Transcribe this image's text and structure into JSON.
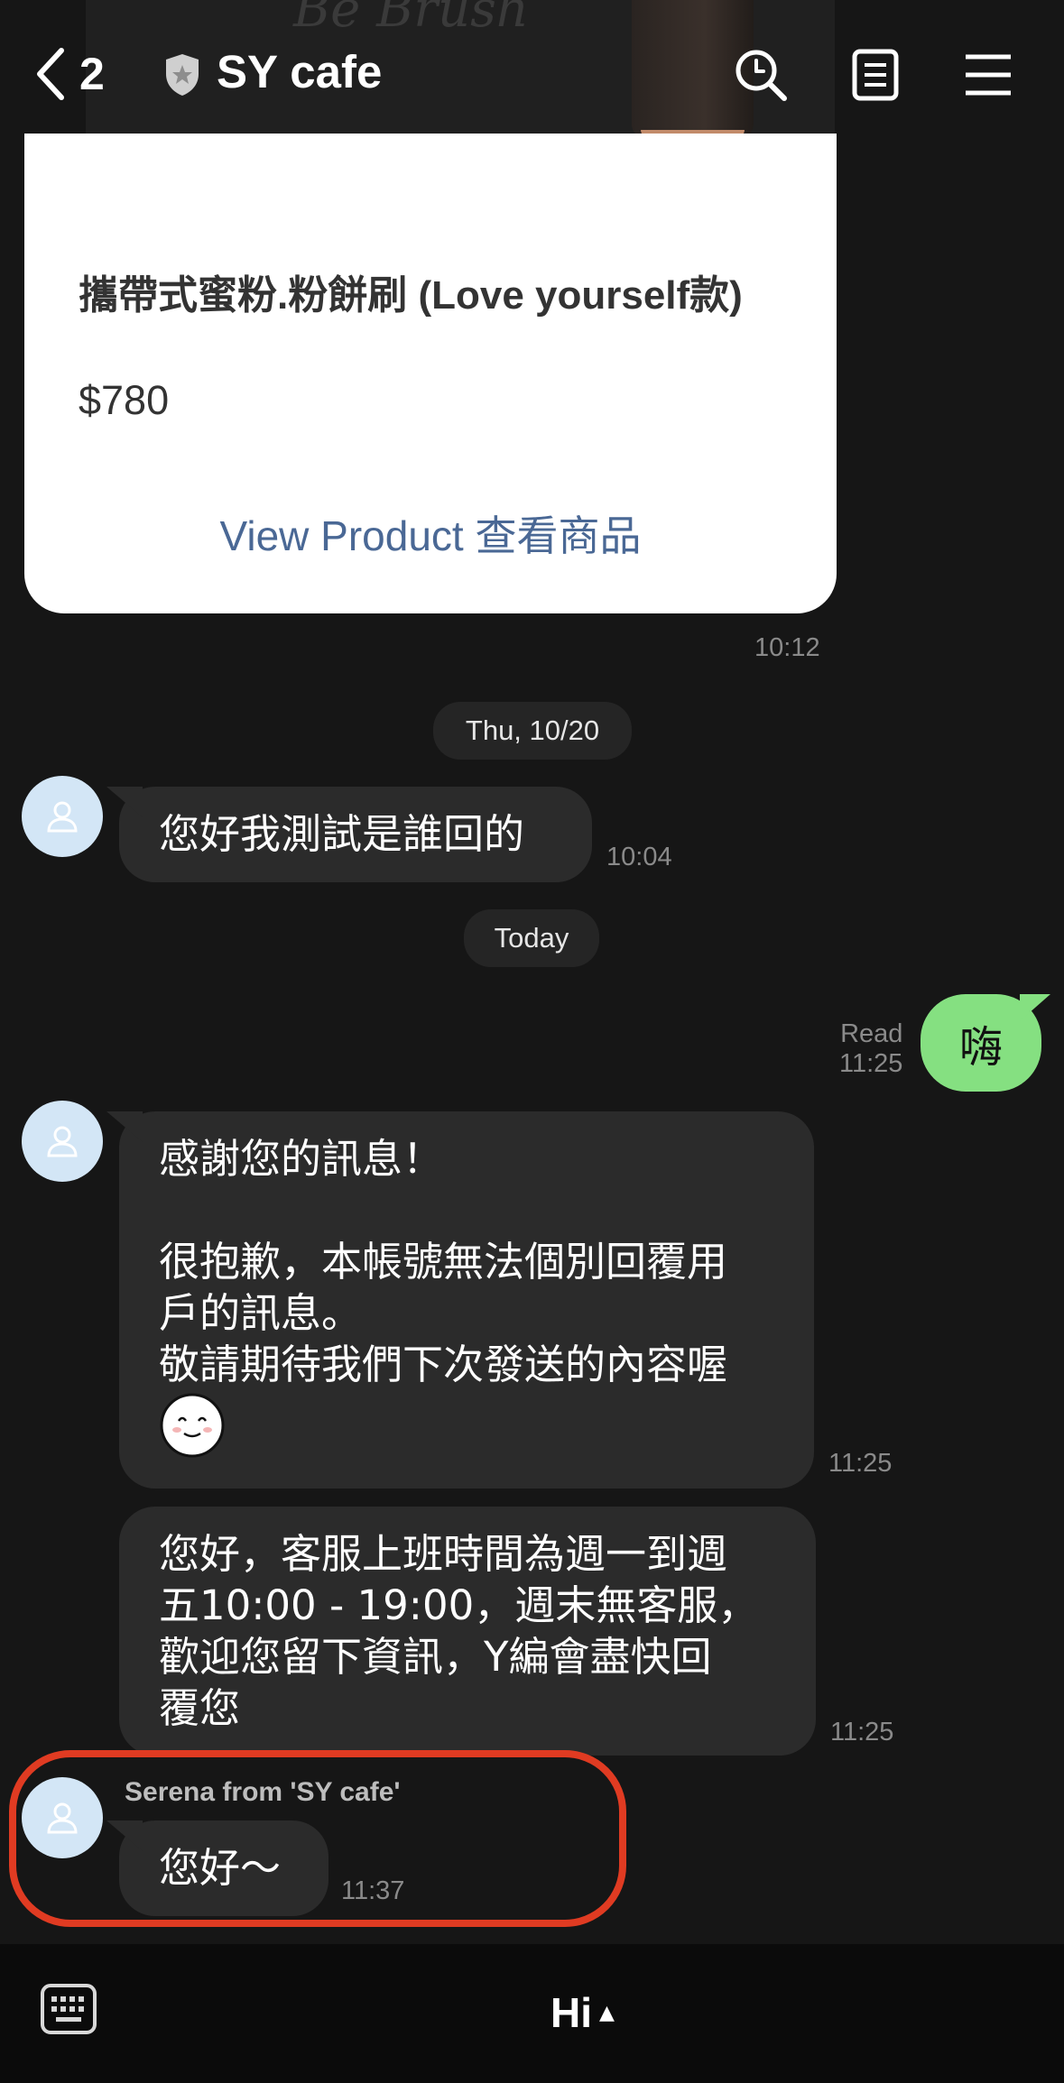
{
  "header": {
    "back_count": "2",
    "title": "SY cafe",
    "icons": [
      "back-chevron-icon",
      "shield-badge-icon",
      "search-icon",
      "notes-icon",
      "menu-icon"
    ]
  },
  "product_card": {
    "name": "攜帶式蜜粉.粉餅刷 (Love yourself款)",
    "price": "$780",
    "view_label": "View Product 查看商品",
    "time": "10:12"
  },
  "dates": {
    "first": "Thu, 10/20",
    "second": "Today"
  },
  "messages": [
    {
      "side": "left",
      "text": "您好我測試是誰回的",
      "time": "10:04"
    },
    {
      "side": "right",
      "text": "嗨",
      "status": "Read",
      "time": "11:25"
    },
    {
      "side": "left",
      "lines": [
        "感謝您的訊息！",
        "",
        "很抱歉，本帳號無法個別回覆用",
        "戶的訊息。",
        "敬請期待我們下次發送的內容喔"
      ],
      "sticker": "smile-face-icon",
      "time": "11:25"
    },
    {
      "side": "left",
      "lines": [
        "您好，客服上班時間為週一到週",
        "五10:00 - 19:00，週末無客服，",
        "歡迎您留下資訊，Y編會盡快回",
        "覆您"
      ],
      "time": "11:25"
    },
    {
      "side": "left",
      "sender": "Serena from 'SY cafe'",
      "text": "您好～",
      "time": "11:37"
    }
  ],
  "bottom_bar": {
    "hi_label": "Hi",
    "arrow": "▲"
  },
  "colors": {
    "background": "#161616",
    "bubble_left": "#2b2b2b",
    "bubble_right": "#85e081",
    "highlight": "#e03b22",
    "link": "#4a6895"
  }
}
